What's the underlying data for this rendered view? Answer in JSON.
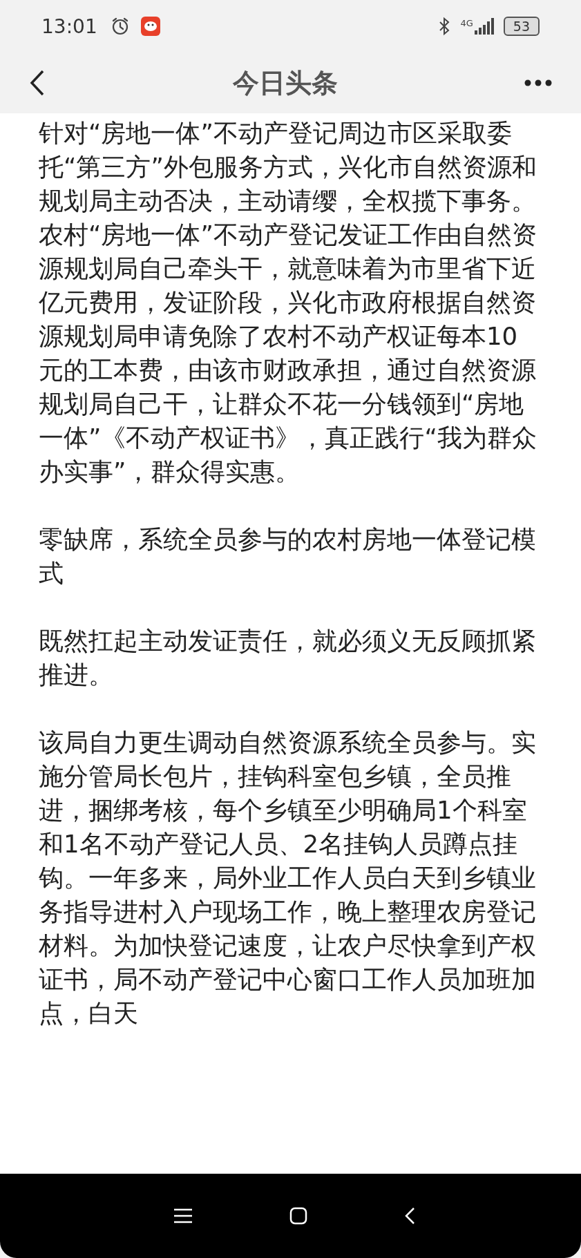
{
  "status_bar": {
    "time": "13:01",
    "network": "4G",
    "battery": "53"
  },
  "header": {
    "title": "今日头条"
  },
  "article": {
    "paragraphs": [
      "针对“房地一体”不动产登记周边市区采取委托“第三方”外包服务方式，兴化市自然资源和规划局主动否决，主动请缨，全权揽下事务。农村“房地一体”不动产登记发证工作由自然资源规划局自己牵头干，就意味着为市里省下近亿元费用，发证阶段，兴化市政府根据自然资源规划局申请免除了农村不动产权证每本10元的工本费，由该市财政承担，通过自然资源规划局自己干，让群众不花一分钱领到“房地一体”《不动产权证书》，真正践行“我为群众办实事”，群众得实惠。",
      "零缺席，系统全员参与的农村房地一体登记模式",
      "既然扛起主动发证责任，就必须义无反顾抓紧推进。",
      "该局自力更生调动自然资源系统全员参与。实施分管局长包片，挂钩科室包乡镇，全员推进，捆绑考核，每个乡镇至少明确局1个科室和1名不动产登记人员、2名挂钩人员蹲点挂钩。一年多来，局外业工作人员白天到乡镇业务指导进村入户现场工作，晚上整理农房登记材料。为加快登记速度，让农户尽快拿到产权证书，局不动产登记中心窗口工作人员加班加点，白天"
    ]
  }
}
